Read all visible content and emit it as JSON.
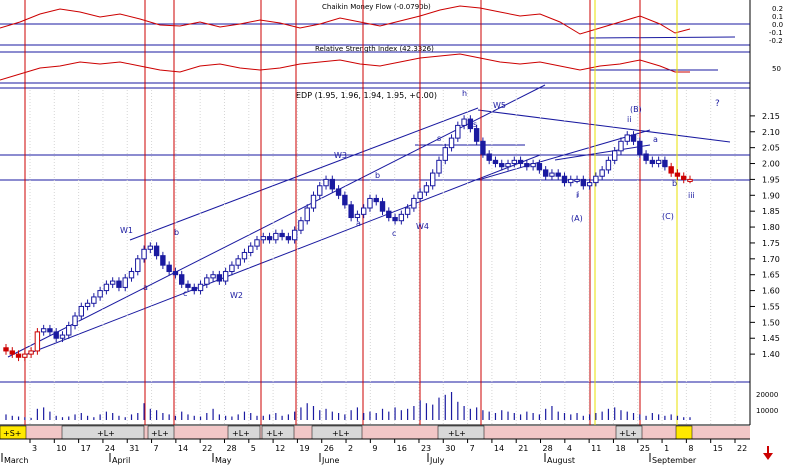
{
  "chart_data": {
    "type": "candlestick",
    "title": "EDP (1.95, 1.96, 1.94, 1.95, +0.00)",
    "panels": {
      "cmf": {
        "title": "Chaikin Money Flow (-0.0790b)",
        "ticks": [
          "0.2",
          "0.1",
          "0.0",
          "-0.1",
          "-0.2"
        ]
      },
      "rsi": {
        "title": "Relative Strength Index (42.3326)",
        "ticks": [
          "50"
        ]
      },
      "price": {
        "ylim": [
          1.35,
          2.2
        ],
        "ticks": [
          1.4,
          1.45,
          1.5,
          1.55,
          1.6,
          1.65,
          1.7,
          1.75,
          1.8,
          1.85,
          1.9,
          1.95,
          2.0,
          2.05,
          2.1,
          2.15
        ],
        "close": [
          1.41,
          1.4,
          1.39,
          1.4,
          1.41,
          1.47,
          1.48,
          1.47,
          1.45,
          1.46,
          1.49,
          1.52,
          1.55,
          1.56,
          1.58,
          1.6,
          1.62,
          1.63,
          1.61,
          1.64,
          1.66,
          1.7,
          1.73,
          1.74,
          1.71,
          1.68,
          1.66,
          1.65,
          1.62,
          1.61,
          1.6,
          1.62,
          1.64,
          1.65,
          1.63,
          1.66,
          1.68,
          1.7,
          1.72,
          1.74,
          1.76,
          1.77,
          1.76,
          1.78,
          1.77,
          1.76,
          1.79,
          1.82,
          1.86,
          1.9,
          1.93,
          1.95,
          1.92,
          1.9,
          1.87,
          1.83,
          1.84,
          1.86,
          1.89,
          1.88,
          1.85,
          1.83,
          1.82,
          1.84,
          1.86,
          1.89,
          1.91,
          1.93,
          1.97,
          2.01,
          2.05,
          2.08,
          2.12,
          2.14,
          2.11,
          2.07,
          2.03,
          2.01,
          2.0,
          1.99,
          2.0,
          2.01,
          2.0,
          1.99,
          2.0,
          1.98,
          1.96,
          1.97,
          1.96,
          1.94,
          1.95,
          1.95,
          1.93,
          1.94,
          1.96,
          1.98,
          2.01,
          2.04,
          2.07,
          2.09,
          2.07,
          2.03,
          2.01,
          2.0,
          2.01,
          1.99,
          1.97,
          1.96,
          1.95,
          1.95
        ],
        "markers": {
          "question": "?",
          "wave_labels": [
            "W1",
            "W2",
            "W3",
            "W4",
            "W5",
            "a",
            "b",
            "c",
            "a",
            "b",
            "c",
            "h",
            "s",
            "s",
            "i",
            "ii",
            "iii",
            "(A)",
            "(B)",
            "(C)",
            "i",
            "a",
            "b"
          ]
        }
      },
      "volume": {
        "ticks": [
          "20000",
          "10000"
        ],
        "values": [
          4000,
          3000,
          2500,
          2000,
          1500,
          8000,
          9000,
          6000,
          3000,
          2000,
          2500,
          4000,
          5000,
          3000,
          2000,
          4000,
          6000,
          5000,
          3000,
          2000,
          4000,
          5000,
          12000,
          8000,
          7000,
          5000,
          4000,
          3000,
          6000,
          4000,
          3000,
          2500,
          5000,
          8000,
          4000,
          3000,
          2500,
          4000,
          6000,
          5000,
          3000,
          3000,
          4000,
          5000,
          3000,
          4000,
          6000,
          9000,
          12000,
          10000,
          7000,
          8000,
          6000,
          5000,
          4000,
          7000,
          9000,
          5000,
          6000,
          5000,
          8000,
          6000,
          9000,
          7000,
          8000,
          10000,
          14000,
          12000,
          11000,
          16000,
          18000,
          20000,
          13000,
          10000,
          8000,
          9000,
          7000,
          6000,
          5000,
          7000,
          6000,
          5000,
          4000,
          6000,
          5000,
          4000,
          8000,
          10000,
          6000,
          5000,
          4000,
          5000,
          3000,
          4000,
          5000,
          6000,
          8000,
          9000,
          7000,
          6000,
          5000,
          4000,
          3000,
          5000,
          4000,
          3000,
          4000,
          3000,
          2000,
          2000
        ]
      }
    },
    "x_axis": {
      "day_ticks": [
        "3",
        "10",
        "17",
        "24",
        "31",
        "7",
        "14",
        "22",
        "28",
        "5",
        "12",
        "19",
        "26",
        "2",
        "9",
        "16",
        "23",
        "30",
        "7",
        "14",
        "21",
        "28",
        "4",
        "11",
        "18",
        "25",
        "1",
        "8",
        "15",
        "22"
      ],
      "month_labels": [
        "March",
        "April",
        "May",
        "June",
        "July",
        "August",
        "September"
      ]
    },
    "signals": [
      "+S+",
      "+L+",
      "+L+",
      "+L+",
      "+L+",
      "+L+",
      "+L+",
      "+L+"
    ]
  }
}
